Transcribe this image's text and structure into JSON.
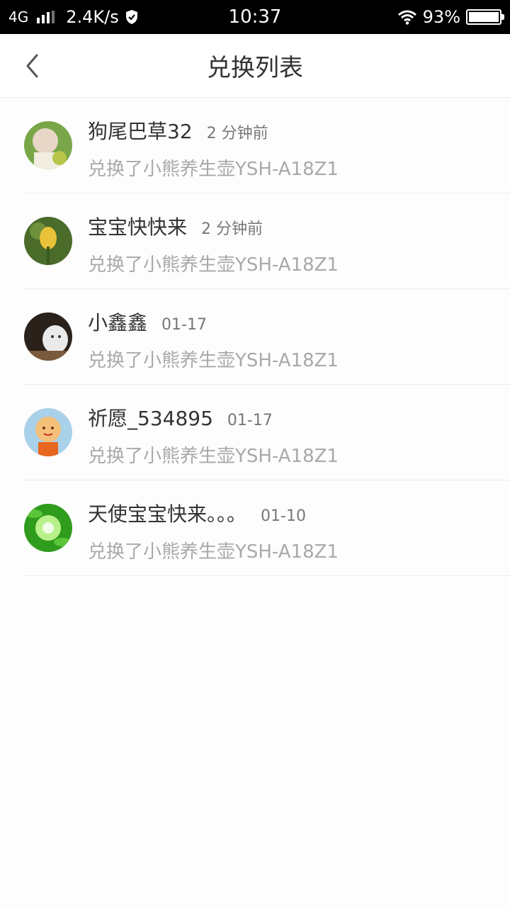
{
  "status_bar": {
    "network": "4G",
    "speed": "2.4K/s",
    "time": "10:37",
    "battery": "93%"
  },
  "nav": {
    "title": "兑换列表",
    "back_icon": "chevron-left-icon"
  },
  "items": [
    {
      "name": "狗尾巴草32",
      "time": "2 分钟前",
      "desc": "兑换了小熊养生壶YSH-A18Z1",
      "avatar_colors": [
        "#7aa64a",
        "#e8d6c7"
      ]
    },
    {
      "name": "宝宝快快来",
      "time": "2 分钟前",
      "desc": "兑换了小熊养生壶YSH-A18Z1",
      "avatar_colors": [
        "#4a6b2a",
        "#e9c23a"
      ]
    },
    {
      "name": "小鑫鑫",
      "time": "01-17",
      "desc": "兑换了小熊养生壶YSH-A18Z1",
      "avatar_colors": [
        "#2a211a",
        "#eaeaea"
      ]
    },
    {
      "name": "祈愿_534895",
      "time": "01-17",
      "desc": "兑换了小熊养生壶YSH-A18Z1",
      "avatar_colors": [
        "#a9d1ea",
        "#f5c07a"
      ]
    },
    {
      "name": "天使宝宝快来。。。",
      "time": "01-10",
      "desc": "兑换了小熊养生壶YSH-A18Z1",
      "avatar_colors": [
        "#2f9c1d",
        "#b8f08a"
      ]
    }
  ]
}
